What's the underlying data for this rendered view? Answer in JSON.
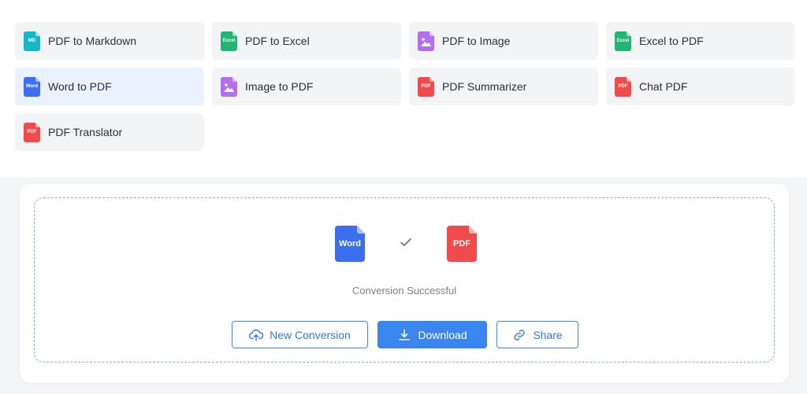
{
  "tools": [
    {
      "label": "PDF to Markdown",
      "icon": "md-file-icon",
      "badge": "MD",
      "color": "#14b8c8"
    },
    {
      "label": "PDF to Excel",
      "icon": "excel-file-icon",
      "badge": "Excel",
      "color": "#22b573"
    },
    {
      "label": "PDF to Image",
      "icon": "image-file-icon",
      "badge": "",
      "color": "#b46cf0"
    },
    {
      "label": "Excel to PDF",
      "icon": "excel-file-icon",
      "badge": "Excel",
      "color": "#22b573"
    },
    {
      "label": "Word to PDF",
      "icon": "word-file-icon",
      "badge": "Word",
      "color": "#3c6ff0",
      "active": true
    },
    {
      "label": "Image to PDF",
      "icon": "image-file-icon",
      "badge": "",
      "color": "#b46cf0"
    },
    {
      "label": "PDF Summarizer",
      "icon": "pdf-file-icon",
      "badge": "PDF",
      "color": "#f04a4a"
    },
    {
      "label": "Chat PDF",
      "icon": "pdf-file-icon",
      "badge": "PDF",
      "color": "#f04a4a"
    },
    {
      "label": "PDF Translator",
      "icon": "pdf-file-icon",
      "badge": "PDF",
      "color": "#f04a4a"
    }
  ],
  "conversion": {
    "from_icon": {
      "label": "Word",
      "icon": "word-file-icon",
      "color": "#3c6ff0"
    },
    "to_icon": {
      "label": "PDF",
      "icon": "pdf-file-icon",
      "color": "#f04a4a"
    },
    "check_icon": "check-icon",
    "status": "Conversion Successful",
    "buttons": {
      "new_conversion": {
        "label": "New Conversion",
        "icon": "cloud-upload-icon"
      },
      "download": {
        "label": "Download",
        "icon": "download-icon"
      },
      "share": {
        "label": "Share",
        "icon": "link-icon"
      }
    }
  },
  "colors": {
    "accent": "#3a86ee",
    "dashed_border": "#7fb0e6",
    "active_card": "#ebf2ff"
  }
}
